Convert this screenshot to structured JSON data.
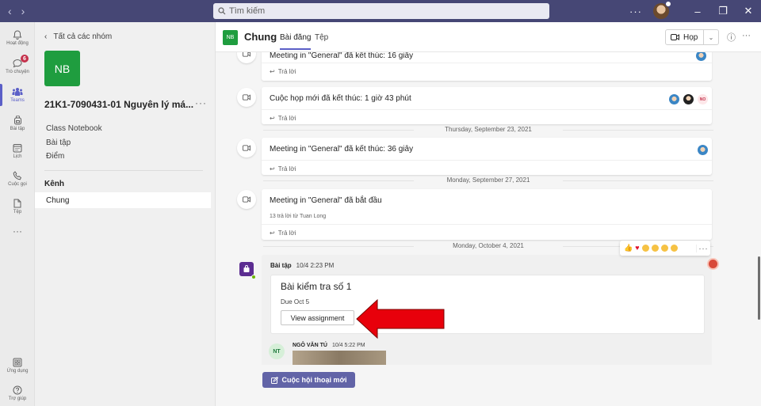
{
  "search": {
    "placeholder": "Tìm kiếm"
  },
  "titlebar": {
    "more": "···",
    "minimize": "–",
    "maximize": "❐",
    "close": "✕"
  },
  "rail": {
    "items": [
      {
        "label": "Hoạt động"
      },
      {
        "label": "Trò chuyện",
        "badge": "6"
      },
      {
        "label": "Teams"
      },
      {
        "label": "Bài tập"
      },
      {
        "label": "Lịch"
      },
      {
        "label": "Cuộc gọi"
      },
      {
        "label": "Tệp"
      },
      {
        "label": "···"
      }
    ],
    "bottom": [
      {
        "label": "Ứng dụng"
      },
      {
        "label": "Trợ giúp"
      }
    ]
  },
  "sidebar": {
    "back": "Tất cả các nhóm",
    "team_initials": "NB",
    "team_name": "21K1-7090431-01 Nguyên lý má...",
    "team_more": "···",
    "links": [
      "Class Notebook",
      "Bài tập",
      "Điểm"
    ],
    "section": "Kênh",
    "channel": "Chung"
  },
  "header": {
    "initials": "NB",
    "title": "Chung",
    "tabs": [
      "Bài đăng",
      "Tệp"
    ],
    "meet_label": "Họp",
    "info": "ⓘ",
    "more": "···"
  },
  "feed": {
    "reply_label": "Trả lời",
    "posts": [
      {
        "title": "Meeting in \"General\" đã kết thúc: 16 giây"
      },
      {
        "title": "Cuộc họp mới đã kết thúc: 1 giờ 43 phút",
        "participant_initials": "NO"
      },
      {
        "title": "Meeting in \"General\" đã kết thúc: 36 giây"
      },
      {
        "title": "Meeting in \"General\" đã bắt đầu",
        "replies": "13 trả lời từ Tuan Long"
      }
    ],
    "dates": [
      "Thursday, September 23, 2021",
      "Monday, September 27, 2021",
      "Monday, October 4, 2021"
    ],
    "assignment": {
      "sender": "Bài tập",
      "time": "10/4 2:23 PM",
      "title": "Bài kiểm tra số 1",
      "due": "Due Oct 5",
      "button": "View assignment"
    },
    "reply_post": {
      "initials": "NT",
      "sender": "NGÔ VĂN TÚ",
      "time": "10/4 5:22 PM"
    },
    "reactions_more": "···"
  },
  "new_conversation": "Cuộc hội thoại mới",
  "colors": {
    "titlebar": "#464775",
    "accent": "#5b5fc7",
    "team": "#1f9d3f",
    "arrow": "#e8000b"
  }
}
